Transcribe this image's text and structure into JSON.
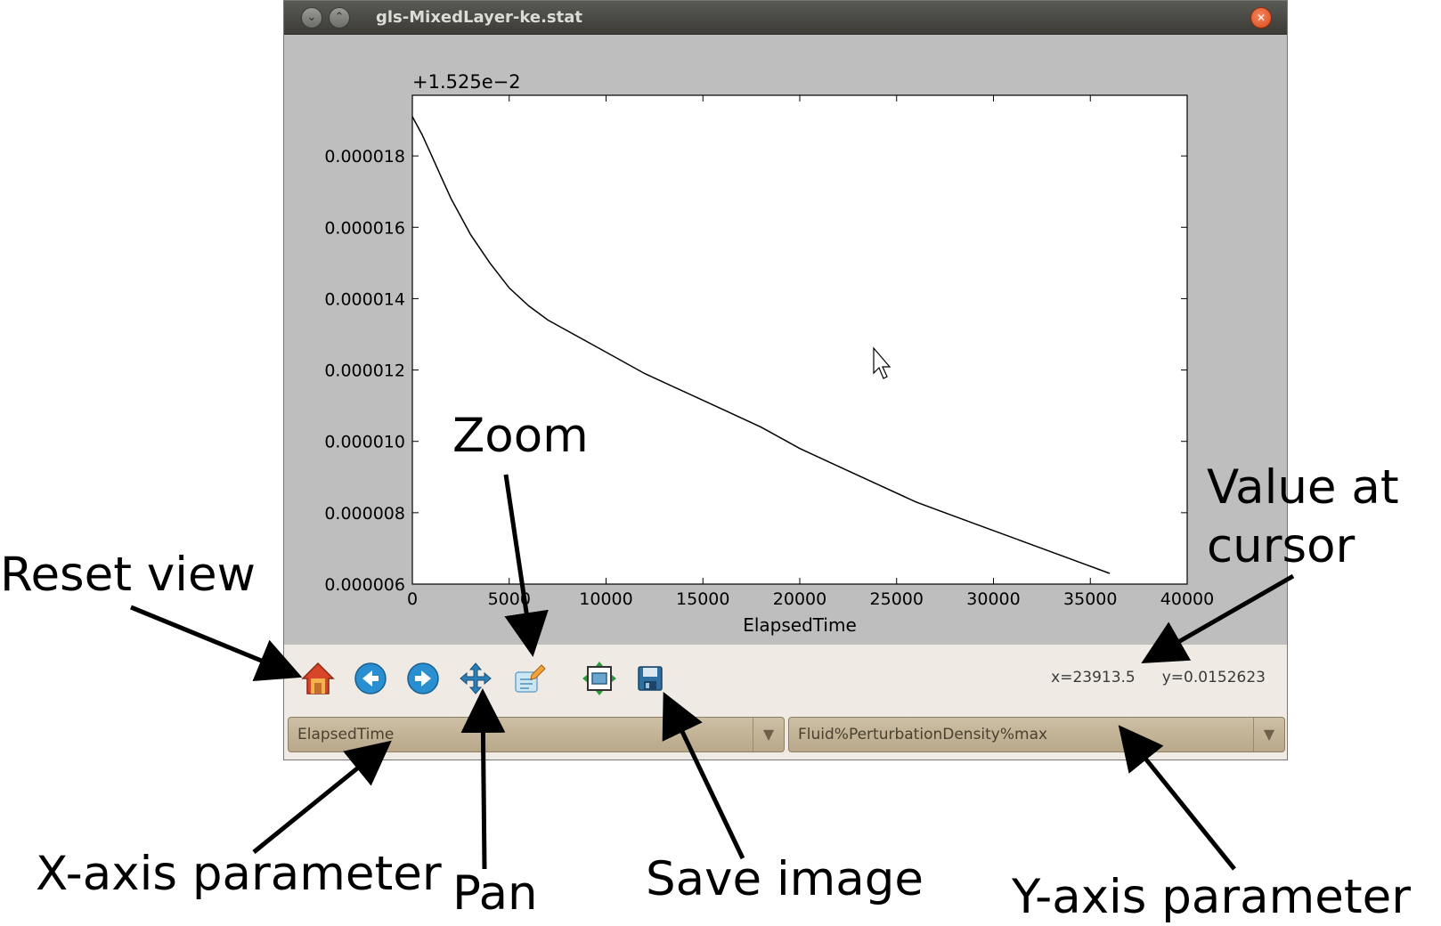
{
  "window": {
    "title": "gls-MixedLayer-ke.stat",
    "controls": [
      "minimize",
      "maximize",
      "close"
    ]
  },
  "chart_data": {
    "type": "line",
    "title": "",
    "offset_label": "+1.525e−2",
    "xlabel": "ElapsedTime",
    "ylabel": "",
    "xlim": [
      0,
      40000
    ],
    "ylim": [
      6e-06,
      1.97e-05
    ],
    "x_ticks": [
      0,
      5000,
      10000,
      15000,
      20000,
      25000,
      30000,
      35000,
      40000
    ],
    "x_tick_labels": [
      "0",
      "5000",
      "10000",
      "15000",
      "20000",
      "25000",
      "30000",
      "35000",
      "40000"
    ],
    "y_ticks": [
      6e-06,
      8e-06,
      1e-05,
      1.2e-05,
      1.4e-05,
      1.6e-05,
      1.8e-05
    ],
    "y_tick_labels": [
      "0.000006",
      "0.000008",
      "0.000010",
      "0.000012",
      "0.000014",
      "0.000016",
      "0.000018"
    ],
    "grid": false,
    "series": [
      {
        "x": [
          0,
          500,
          1000,
          1500,
          2000,
          3000,
          4000,
          5000,
          6000,
          7000,
          8000,
          9000,
          10000,
          12000,
          14000,
          16000,
          18000,
          20000,
          22000,
          24000,
          26000,
          28000,
          30000,
          32000,
          34000,
          36000
        ],
        "y": [
          1.91e-05,
          1.86e-05,
          1.8e-05,
          1.74e-05,
          1.68e-05,
          1.58e-05,
          1.5e-05,
          1.43e-05,
          1.38e-05,
          1.34e-05,
          1.31e-05,
          1.28e-05,
          1.25e-05,
          1.19e-05,
          1.14e-05,
          1.09e-05,
          1.04e-05,
          9.8e-06,
          9.3e-06,
          8.8e-06,
          8.3e-06,
          7.9e-06,
          7.5e-06,
          7.1e-06,
          6.7e-06,
          6.3e-06
        ],
        "color": "#000000"
      }
    ]
  },
  "toolbar": {
    "tools": [
      "home-icon",
      "back-icon",
      "forward-icon",
      "pan-icon",
      "zoom-icon",
      "subplots-icon",
      "save-icon"
    ],
    "coord_x": "x=23913.5",
    "coord_y": "y=0.0152623"
  },
  "selectors": {
    "x_param": "ElapsedTime",
    "y_param": "Fluid%PerturbationDensity%max"
  },
  "annotations": {
    "reset_view": "Reset view",
    "zoom": "Zoom",
    "value_at_cursor_1": "Value at",
    "value_at_cursor_2": "cursor",
    "x_axis_parameter": "X-axis parameter",
    "pan": "Pan",
    "save_image": "Save image",
    "y_axis_parameter": "Y-axis parameter"
  },
  "colors": {
    "window_bg": "#bebebe",
    "toolbar_bg": "#efebe4",
    "combo_bg": "#c4b497",
    "titlebar": "#3c3b37",
    "close_button": "#e05a2b"
  }
}
